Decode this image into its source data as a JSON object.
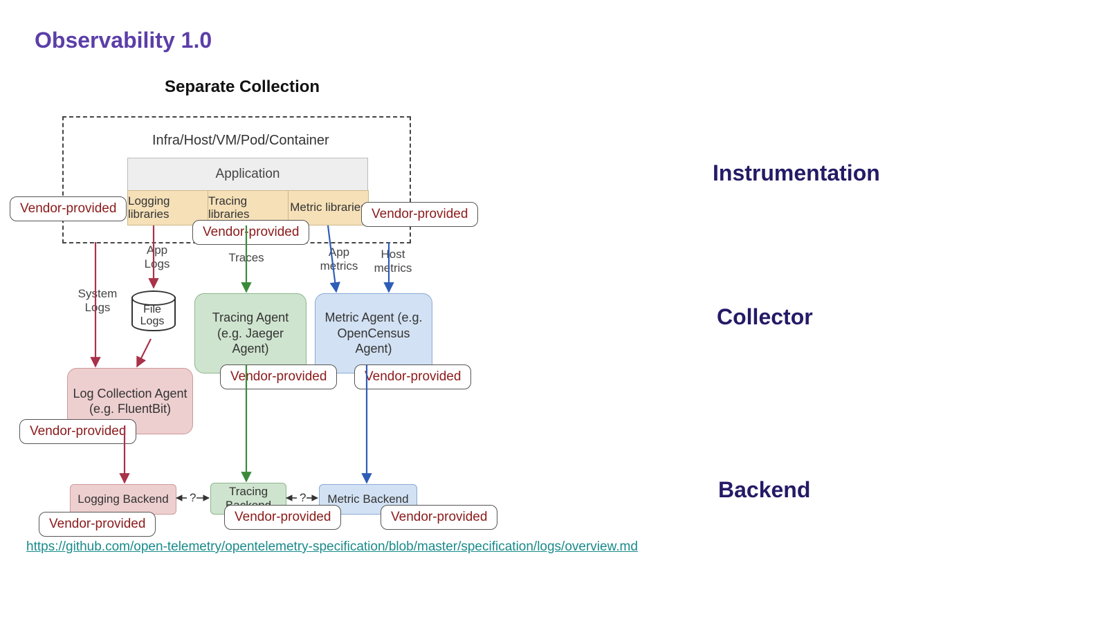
{
  "title": "Observability 1.0",
  "diagram_title": "Separate Collection",
  "infra_label": "Infra/Host/VM/Pod/Container",
  "application_label": "Application",
  "libs": {
    "logging": "Logging libraries",
    "tracing": "Tracing libraries",
    "metric": "Metric libraries"
  },
  "vendor_label": "Vendor-provided",
  "flows": {
    "system_logs": "System Logs",
    "app_logs": "App Logs",
    "file_logs": "File Logs",
    "traces": "Traces",
    "app_metrics": "App metrics",
    "host_metrics": "Host metrics"
  },
  "agents": {
    "log": "Log Collection Agent (e.g. FluentBit)",
    "tracing": "Tracing Agent (e.g. Jaeger Agent)",
    "metric": "Metric Agent (e.g. OpenCensus Agent)"
  },
  "backends": {
    "logging": "Logging Backend",
    "tracing": "Tracing Backend",
    "metric": "Metric Backend"
  },
  "connectors": {
    "question": "?"
  },
  "sections": {
    "instrumentation": "Instrumentation",
    "collector": "Collector",
    "backend": "Backend"
  },
  "source_link": "https://github.com/open-telemetry/opentelemetry-specification/blob/master/specification/logs/overview.md",
  "colors": {
    "log": "#a8324a",
    "trace": "#3a8a3a",
    "metric": "#2e5db8",
    "log_fill": "#eecfd0",
    "trace_fill": "#cfe4cf",
    "metric_fill": "#d2e1f3"
  }
}
